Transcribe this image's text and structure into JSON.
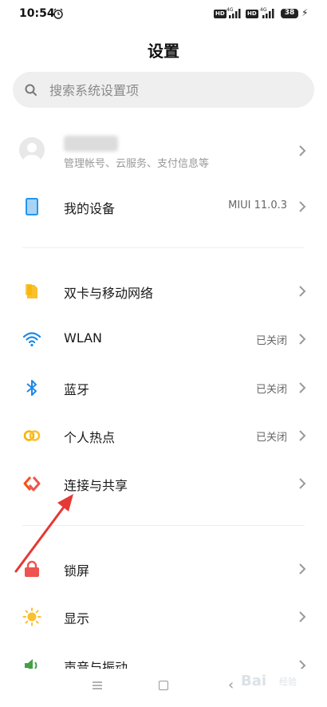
{
  "status_bar": {
    "time": "10:54",
    "battery": "38",
    "hd1": "HD",
    "hd2": "HD",
    "network1": "4G",
    "network2": "4G"
  },
  "page_title": "设置",
  "search": {
    "placeholder": "搜索系统设置项"
  },
  "account": {
    "subtitle": "管理帐号、云服务、支付信息等"
  },
  "items": [
    {
      "label": "我的设备",
      "value": "MIUI 11.0.3",
      "icon": "device-icon",
      "color": "#2196f3"
    },
    {
      "label": "双卡与移动网络",
      "value": "",
      "icon": "sim-card-icon",
      "color": "#f5b400"
    },
    {
      "label": "WLAN",
      "value": "已关闭",
      "icon": "wifi-icon",
      "color": "#1e88e5"
    },
    {
      "label": "蓝牙",
      "value": "已关闭",
      "icon": "bluetooth-icon",
      "color": "#1e88e5"
    },
    {
      "label": "个人热点",
      "value": "已关闭",
      "icon": "hotspot-icon",
      "color": "#f5b400"
    },
    {
      "label": "连接与共享",
      "value": "",
      "icon": "connection-sharing-icon",
      "color": "#f4511e"
    },
    {
      "label": "锁屏",
      "value": "",
      "icon": "lock-icon",
      "color": "#f4511e"
    },
    {
      "label": "显示",
      "value": "",
      "icon": "display-brightness-icon",
      "color": "#f5b400"
    },
    {
      "label": "声音与振动",
      "value": "",
      "icon": "sound-icon",
      "color": "#43a047"
    }
  ],
  "watermark": {
    "brand": "Bai",
    "sub": "经验"
  },
  "colors": {
    "annotation_arrow": "#e53935"
  }
}
